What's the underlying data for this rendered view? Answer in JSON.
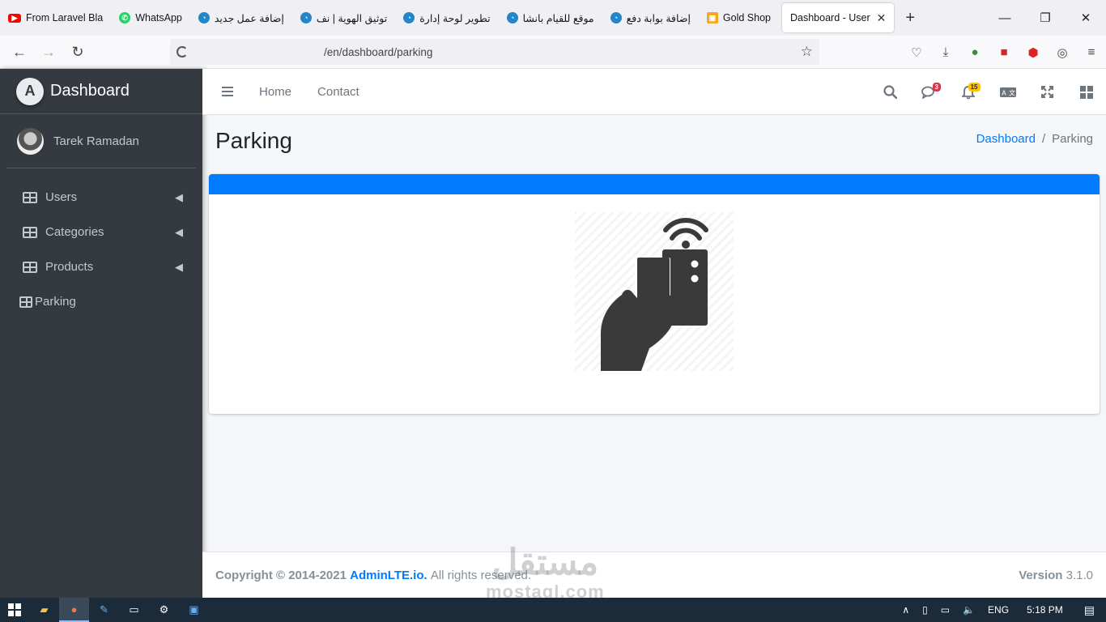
{
  "browser": {
    "tabs": [
      {
        "label": "From Laravel Bla",
        "icon": "youtube-icon",
        "color": "#ff0000"
      },
      {
        "label": "WhatsApp",
        "icon": "whatsapp-icon",
        "color": "#25d366"
      },
      {
        "label": "إضافة عمل جديد",
        "icon": "mostaql-icon",
        "color": "#2386c8"
      },
      {
        "label": "توثيق الهوية | نف",
        "icon": "mostaql-icon",
        "color": "#2386c8"
      },
      {
        "label": "تطوير لوحة إدارة",
        "icon": "mostaql-icon",
        "color": "#2386c8"
      },
      {
        "label": "موقع للقيام بانشا",
        "icon": "mostaql-icon",
        "color": "#2386c8"
      },
      {
        "label": "إضافة بوابة دفع",
        "icon": "mostaql-icon",
        "color": "#2386c8"
      },
      {
        "label": "Gold Shop",
        "icon": "shop-icon",
        "color": "#f5a623"
      },
      {
        "label": "Dashboard - User",
        "icon": "",
        "color": "",
        "active": true
      }
    ],
    "url": "/en/dashboard/parking"
  },
  "sidebar": {
    "brand": "Dashboard",
    "user": "Tarek Ramadan",
    "items": [
      {
        "label": "Users"
      },
      {
        "label": "Categories"
      },
      {
        "label": "Products"
      },
      {
        "label": "Parking"
      }
    ]
  },
  "header": {
    "links": [
      "Home",
      "Contact"
    ],
    "messages_badge": "3",
    "notifications_badge": "15"
  },
  "page": {
    "title": "Parking",
    "breadcrumb": [
      "Dashboard",
      "Parking"
    ],
    "accent": "#007bff"
  },
  "footer": {
    "copyright": "Copyright © 2014-2021",
    "link": "AdminLTE.io.",
    "rights": "All rights reserved.",
    "version_label": "Version",
    "version": "3.1.0"
  },
  "watermark": {
    "arabic": "مستقل",
    "latin": "mostaql.com"
  },
  "taskbar": {
    "lang": "ENG",
    "time": "5:18 PM"
  }
}
